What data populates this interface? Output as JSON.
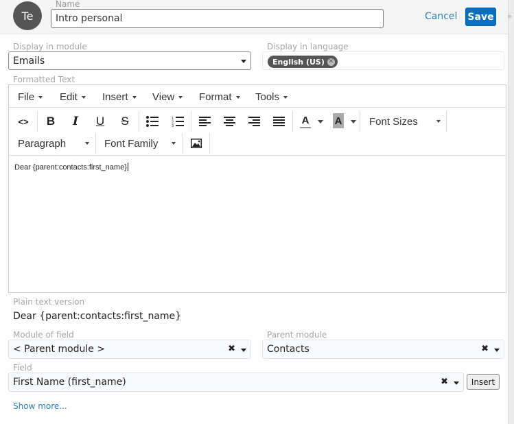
{
  "header": {
    "avatar_initials": "Te",
    "name_label": "Name",
    "name_value": "Intro personal",
    "cancel_label": "Cancel",
    "save_label": "Save",
    "collapse_icon": "»"
  },
  "display_module": {
    "label": "Display in module",
    "value": "Emails"
  },
  "display_language": {
    "label": "Display in language",
    "tags": [
      {
        "label": "English (US)"
      }
    ]
  },
  "formatted_text": {
    "label": "Formatted Text",
    "menu": [
      {
        "label": "File"
      },
      {
        "label": "Edit"
      },
      {
        "label": "Insert"
      },
      {
        "label": "View"
      },
      {
        "label": "Format"
      },
      {
        "label": "Tools"
      }
    ],
    "toolbar": {
      "source_code": "<>",
      "bold": "B",
      "italic": "I",
      "underline": "U",
      "strikethrough": "S",
      "text_color": "A",
      "background_color": "A",
      "font_sizes": "Font Sizes",
      "paragraph": "Paragraph",
      "font_family": "Font Family"
    },
    "content": "Dear {parent:contacts:first_name}"
  },
  "plain_text": {
    "label": "Plain text version",
    "value": "Dear {parent:contacts:first_name}"
  },
  "module_of_field": {
    "label": "Module of field",
    "value": "< Parent module >"
  },
  "parent_module": {
    "label": "Parent module",
    "value": "Contacts"
  },
  "field": {
    "label": "Field",
    "value": "First Name (first_name)",
    "insert_label": "Insert"
  },
  "show_more_label": "Show more...",
  "colors": {
    "accent": "#0b6fc0",
    "link": "#2a7fc1",
    "avatar_bg": "#555555"
  }
}
